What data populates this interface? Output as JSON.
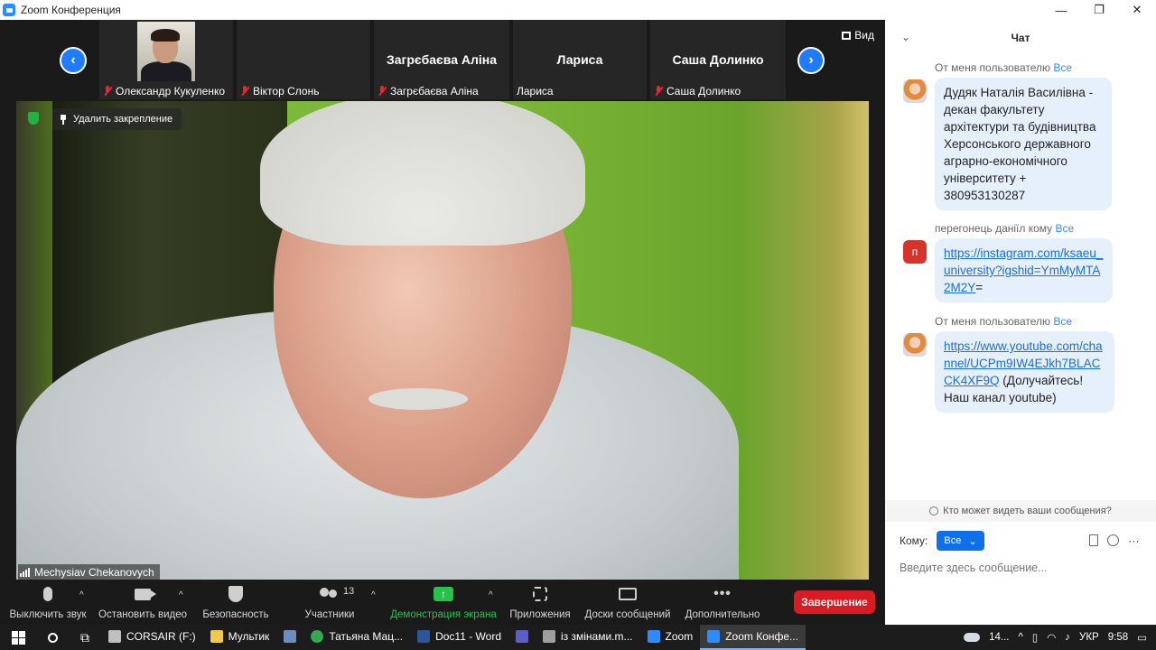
{
  "window": {
    "title": "Zoom Конференция",
    "controls": [
      "—",
      "❐",
      "✕"
    ]
  },
  "strip": {
    "view_label": "Вид",
    "tiles": [
      {
        "label": "Олександр Кукуленко",
        "big_name": "",
        "muted": true,
        "has_video": true
      },
      {
        "label": "Віктор Слонь",
        "big_name": "",
        "muted": true,
        "has_video": false
      },
      {
        "label": "Загрєбаєва Аліна",
        "big_name": "Загрєбаєва Аліна",
        "muted": true,
        "has_video": false
      },
      {
        "label": "Лариса",
        "big_name": "Лариса",
        "muted": false,
        "has_video": false
      },
      {
        "label": "Саша Долинко",
        "big_name": "Саша Долинко",
        "muted": true,
        "has_video": false
      }
    ]
  },
  "main_video": {
    "unpin_label": "Удалить закрепление",
    "speaker_name": "Mechysiav Chekanovych"
  },
  "toolbar": {
    "mute_label": "Выключить звук",
    "video_label": "Остановить видео",
    "security_label": "Безопасность",
    "participants_label": "Участники",
    "participants_count": "13",
    "share_label": "Демонстрация экрана",
    "apps_label": "Приложения",
    "whiteboards_label": "Доски сообщений",
    "more_label": "Дополнительно",
    "end_label": "Завершение"
  },
  "chat": {
    "title": "Чат",
    "messages": [
      {
        "from": "От меня пользователю",
        "to": "Все",
        "text": "Дудяк Наталія Василівна - декан факультету архітектури та будівництва Херсонського державного аграрно-економічного університету + 380953130287"
      },
      {
        "from": "перегонець даніїл кому",
        "to": "Все",
        "avatar_letter": "п",
        "link": "https://instagram.com/ksaeu_university?igshid=YmMyMTA2M2Y",
        "suffix": "="
      },
      {
        "from": "От меня пользователю",
        "to": "Все",
        "link": "https://www.youtube.com/channel/UCPm9IW4EJkh7BLACCK4XF9Q",
        "suffix": " (Долучайтесь! Наш канал youtube)"
      }
    ],
    "who_can_see": "Кто может видеть ваши сообщения?",
    "to_label": "Кому:",
    "to_value": "Все",
    "input_placeholder": "Введите здесь сообщение..."
  },
  "taskbar": {
    "items": [
      {
        "label": "CORSAIR (F:)",
        "color": "#bfbfbf"
      },
      {
        "label": "Мультик",
        "color": "#f2c94c"
      },
      {
        "label": "",
        "color": "#6c8ebf"
      },
      {
        "label": "Татьяна Мац...",
        "color": "#34a853"
      },
      {
        "label": "Doc11 - Word",
        "color": "#2b579a"
      },
      {
        "label": "",
        "color": "#5b5fc7"
      },
      {
        "label": "із змінами.m...",
        "color": "#9e9e9e"
      },
      {
        "label": "Zoom",
        "color": "#2d8cff"
      },
      {
        "label": "Zoom Конфе...",
        "color": "#2d8cff"
      }
    ],
    "weather": "14...",
    "language": "УКР",
    "time": "9:58"
  }
}
